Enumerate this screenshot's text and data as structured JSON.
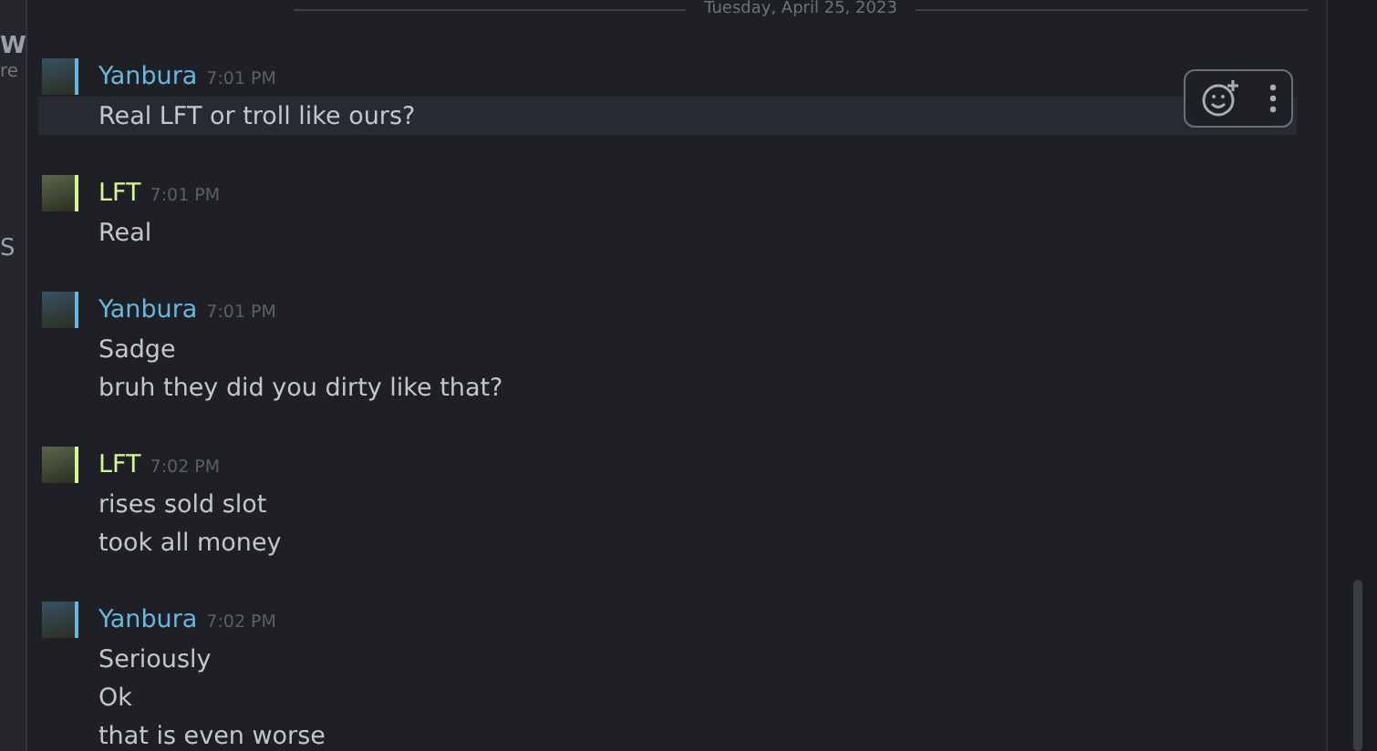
{
  "left_fragments": [
    "W",
    "re",
    "S"
  ],
  "date_divider": "Tuesday, April 25, 2023",
  "messages": [
    {
      "author": "Yanbura",
      "time": "7:01 PM",
      "color": "#6bb6e0",
      "lines": [
        {
          "text": "Real LFT or troll like ours?",
          "highlighted": true
        }
      ]
    },
    {
      "author": "LFT",
      "time": "7:01 PM",
      "color": "#d4f59a",
      "lines": [
        {
          "text": "Real",
          "highlighted": false
        }
      ]
    },
    {
      "author": "Yanbura",
      "time": "7:01 PM",
      "color": "#6bb6e0",
      "lines": [
        {
          "text": "Sadge",
          "highlighted": false
        },
        {
          "text": "bruh they did you dirty like that?",
          "highlighted": false
        }
      ]
    },
    {
      "author": "LFT",
      "time": "7:02 PM",
      "color": "#d4f59a",
      "lines": [
        {
          "text": "rises sold slot",
          "highlighted": false
        },
        {
          "text": "took all money",
          "highlighted": false
        }
      ]
    },
    {
      "author": "Yanbura",
      "time": "7:02 PM",
      "color": "#6bb6e0",
      "lines": [
        {
          "text": "Seriously",
          "highlighted": false
        },
        {
          "text": "Ok",
          "highlighted": false
        },
        {
          "text": "that is even worse",
          "highlighted": false
        }
      ]
    }
  ]
}
